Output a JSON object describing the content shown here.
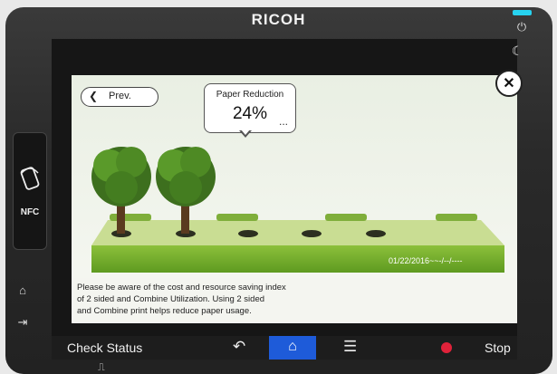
{
  "device": {
    "brand": "RICOH",
    "nfc_label": "NFC"
  },
  "panel": {
    "prev_label": "Prev.",
    "bubble_title": "Paper Reduction",
    "bubble_value": "24%",
    "bubble_more": "...",
    "date_text": "01/22/2016~~-/--/----",
    "message_lines": [
      "Please be aware of the cost and resource saving index",
      "of 2 sided and Combine Utilization. Using 2 sided",
      "and Combine print helps reduce paper usage."
    ]
  },
  "taskbar": {
    "check_status_label": "Check Status",
    "stop_label": "Stop"
  },
  "colors": {
    "home_active": "#1e5bd9",
    "stop": "#e0223a",
    "status_led": "#27d3f0"
  }
}
